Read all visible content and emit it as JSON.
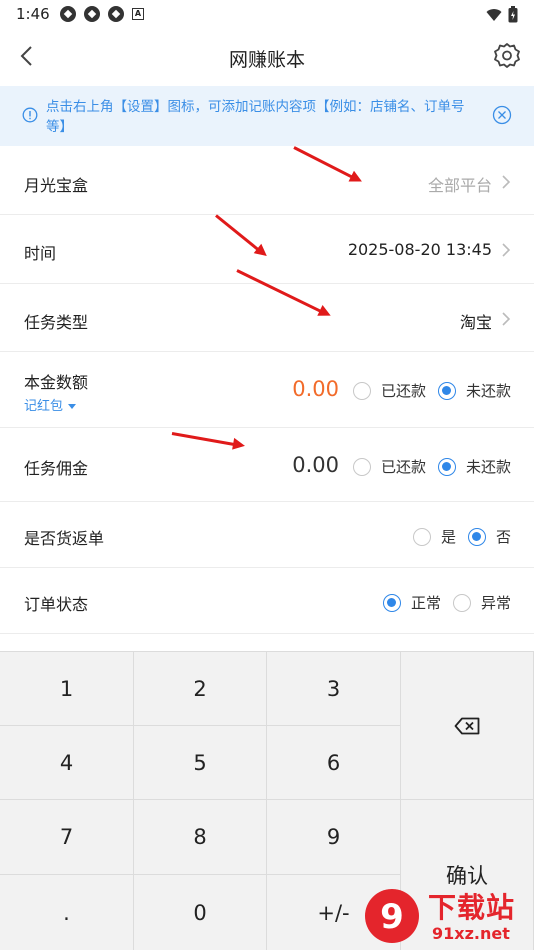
{
  "status_bar": {
    "time": "1:46",
    "a_icon": "A"
  },
  "header": {
    "title": "网赚账本"
  },
  "notice": {
    "text": "点击右上角【设置】图标，可添加记账内容项【例如：店铺名、订单号等】"
  },
  "rows": {
    "platform": {
      "label": "月光宝盒",
      "value": "全部平台"
    },
    "time": {
      "label": "时间",
      "value": "2025-08-20 13:45"
    },
    "task_type": {
      "label": "任务类型",
      "value": "淘宝"
    },
    "principal": {
      "label": "本金数额",
      "sub_link": "记红包",
      "amount": "0.00",
      "options": [
        "已还款",
        "未还款"
      ],
      "selected": "未还款"
    },
    "commission": {
      "label": "任务佣金",
      "amount": "0.00",
      "options": [
        "已还款",
        "未还款"
      ],
      "selected": "未还款"
    },
    "return_goods": {
      "label": "是否货返单",
      "options": [
        "是",
        "否"
      ],
      "selected": "否"
    },
    "order_status": {
      "label": "订单状态",
      "options": [
        "正常",
        "异常"
      ],
      "selected": "正常"
    }
  },
  "keypad": {
    "keys": [
      "1",
      "2",
      "3",
      "4",
      "5",
      "6",
      "7",
      "8",
      "9",
      ".",
      "0",
      "+/-"
    ],
    "backspace_icon": "backspace-icon",
    "confirm_label": "确认"
  },
  "watermark": {
    "text": "下载站",
    "url": "91xz.net",
    "logo_glyph": "9"
  },
  "colors": {
    "accent": "#2f87e8",
    "amount_highlight": "#f26b2a",
    "notice_bg": "#eaf3fc",
    "annotation_arrow": "#e01a1a"
  }
}
